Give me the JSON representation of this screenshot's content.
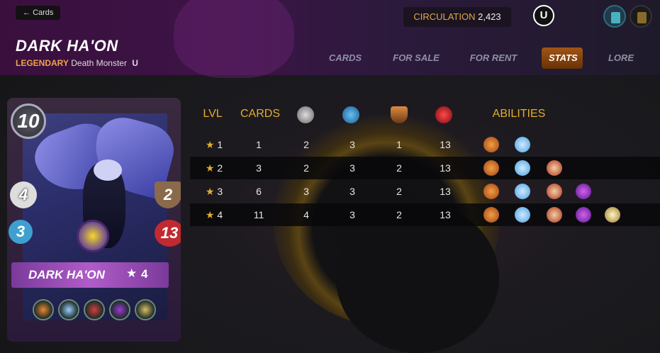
{
  "header": {
    "back_label": "Cards",
    "circulation_label": "CIRCULATION",
    "circulation_value": "2,423",
    "edition_badge": "U",
    "card_name": "DARK HA'ON",
    "rarity": "LEGENDARY",
    "type_line": "Death Monster",
    "type_badge": "U"
  },
  "tabs": [
    {
      "label": "CARDS",
      "active": false
    },
    {
      "label": "FOR SALE",
      "active": false
    },
    {
      "label": "FOR RENT",
      "active": false
    },
    {
      "label": "STATS",
      "active": true
    },
    {
      "label": "LORE",
      "active": false
    }
  ],
  "card": {
    "mana": "10",
    "melee": "4",
    "armor": "2",
    "speed": "3",
    "health": "13",
    "plate_name": "DARK HA'ON",
    "plate_level": "4",
    "abilities": [
      "ability-fire-icon",
      "ability-wings-icon",
      "ability-axe-icon",
      "ability-purple-icon",
      "ability-shield-icon"
    ]
  },
  "stats_table": {
    "headers": {
      "lvl": "LVL",
      "cards": "CARDS",
      "melee_icon": "melee-attack-icon",
      "speed_icon": "speed-icon",
      "armor_icon": "armor-icon",
      "health_icon": "health-icon",
      "abilities": "ABILITIES"
    },
    "rows": [
      {
        "level": "1",
        "cards": "1",
        "melee": "2",
        "speed": "3",
        "armor": "1",
        "health": "13",
        "abilities": [
          "ability-fire-icon",
          "ability-wings-icon"
        ]
      },
      {
        "level": "2",
        "cards": "3",
        "melee": "2",
        "speed": "3",
        "armor": "2",
        "health": "13",
        "abilities": [
          "ability-fire-icon",
          "ability-wings-icon",
          "ability-axe-icon"
        ]
      },
      {
        "level": "3",
        "cards": "6",
        "melee": "3",
        "speed": "3",
        "armor": "2",
        "health": "13",
        "abilities": [
          "ability-fire-icon",
          "ability-wings-icon",
          "ability-axe-icon",
          "ability-purple-icon"
        ]
      },
      {
        "level": "4",
        "cards": "11",
        "melee": "4",
        "speed": "3",
        "armor": "2",
        "health": "13",
        "abilities": [
          "ability-fire-icon",
          "ability-wings-icon",
          "ability-axe-icon",
          "ability-purple-icon",
          "ability-shield-icon"
        ]
      }
    ]
  },
  "colors": {
    "accent": "#e3ad2e",
    "rarity": "#f0a544",
    "active_tab": "#a05514"
  }
}
